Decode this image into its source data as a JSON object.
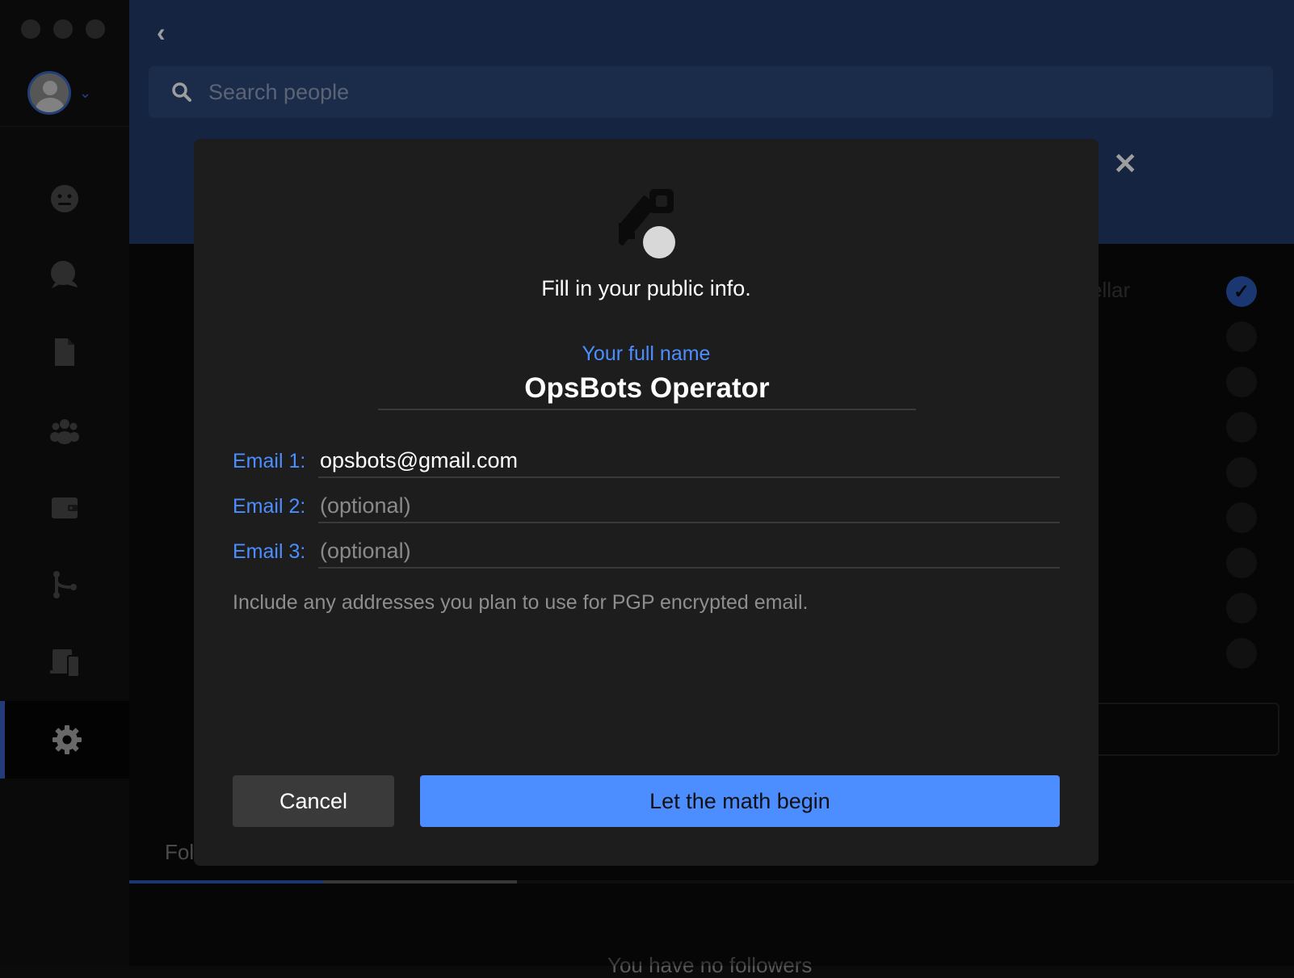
{
  "search": {
    "placeholder": "Search people"
  },
  "background": {
    "partial_text_right": "ellar",
    "tab_partial": "Fol",
    "followers_partial": "You have no followers"
  },
  "modal": {
    "title": "Fill in your public info.",
    "name_label": "Your full name",
    "name_value": "OpsBots Operator",
    "emails": [
      {
        "label": "Email 1:",
        "value": "opsbots@gmail.com",
        "placeholder": ""
      },
      {
        "label": "Email 2:",
        "value": "",
        "placeholder": "(optional)"
      },
      {
        "label": "Email 3:",
        "value": "",
        "placeholder": "(optional)"
      }
    ],
    "hint": "Include any addresses you plan to use for PGP encrypted email.",
    "cancel_label": "Cancel",
    "submit_label": "Let the math begin"
  },
  "colors": {
    "accent": "#4c8dff",
    "header": "#213a6a",
    "modal_bg": "#1d1d1d"
  },
  "icons": [
    "back-icon",
    "search-icon",
    "close-icon",
    "key-icon",
    "avatar",
    "chevron-down-icon",
    "people-icon",
    "chat-icon",
    "files-icon",
    "teams-icon",
    "wallet-icon",
    "git-icon",
    "devices-icon",
    "gear-icon"
  ]
}
